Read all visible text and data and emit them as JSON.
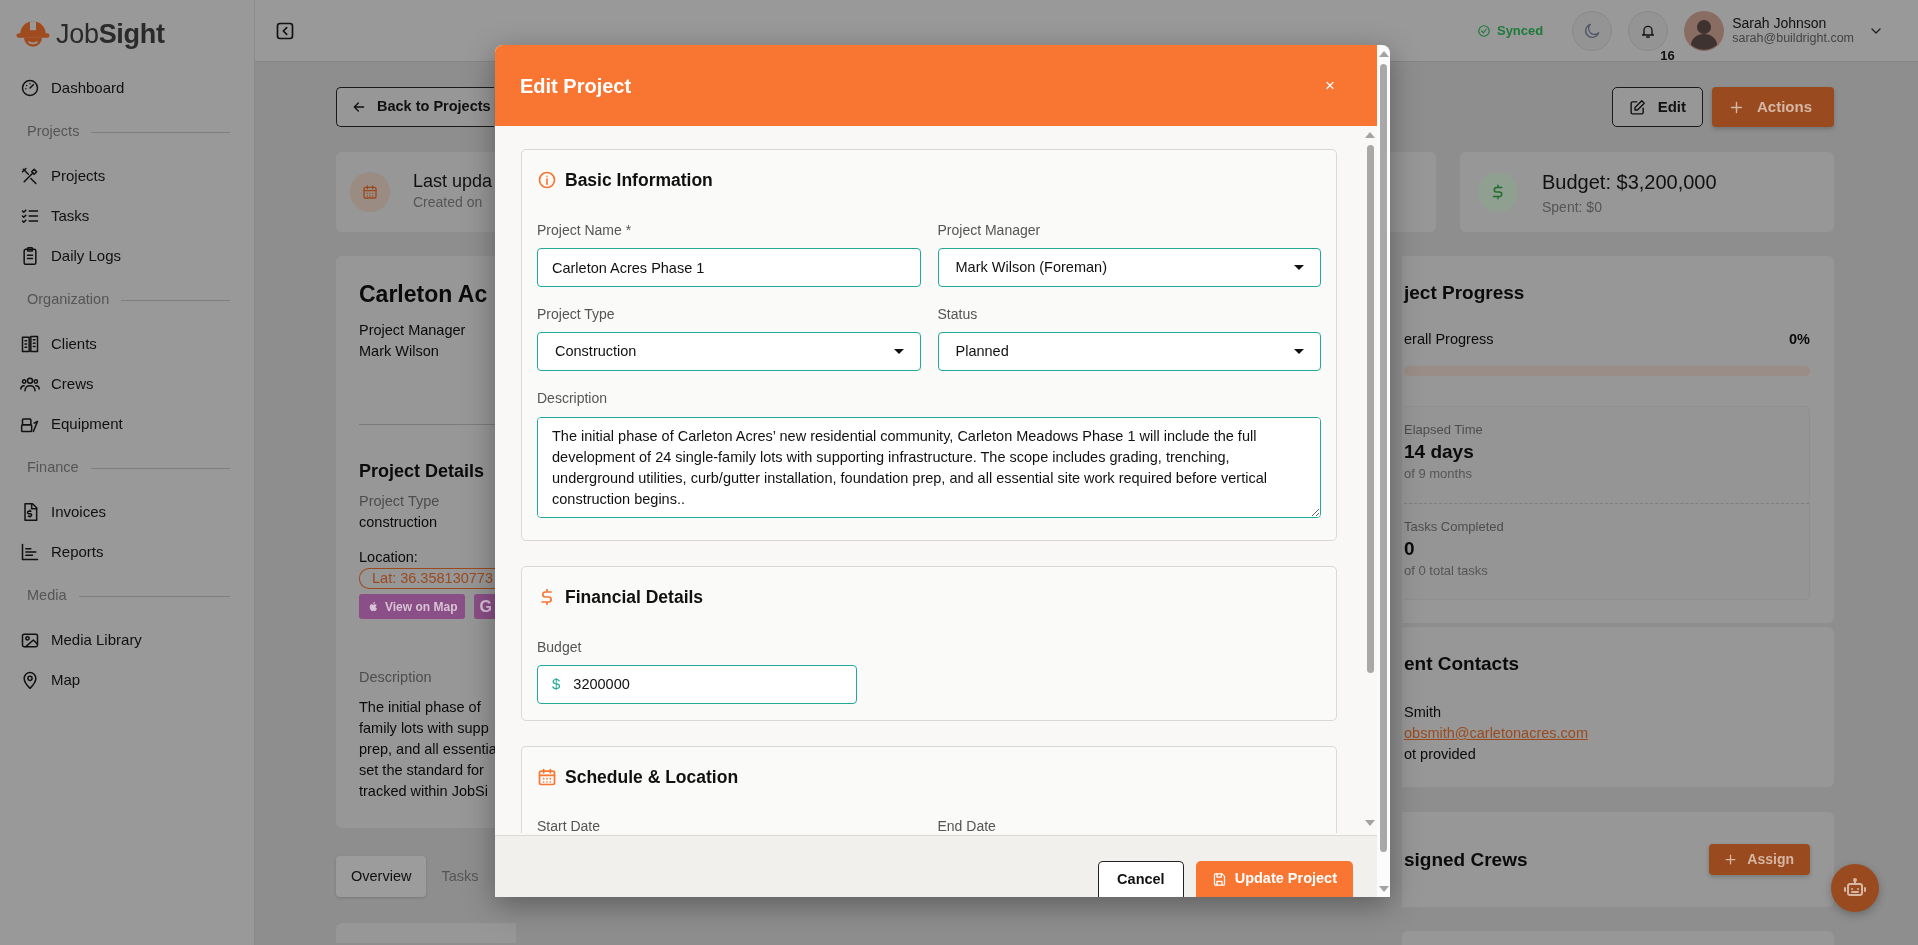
{
  "sidebar": {
    "logo": "Job**Sight**",
    "items": [
      {
        "kind": "link",
        "label": "Dashboard"
      },
      {
        "kind": "heading",
        "label": "Projects"
      },
      {
        "kind": "link",
        "label": "Projects"
      },
      {
        "kind": "link",
        "label": "Tasks"
      },
      {
        "kind": "link",
        "label": "Daily Logs"
      },
      {
        "kind": "heading",
        "label": "Organization"
      },
      {
        "kind": "link",
        "label": "Clients"
      },
      {
        "kind": "link",
        "label": "Crews"
      },
      {
        "kind": "link",
        "label": "Equipment"
      },
      {
        "kind": "heading",
        "label": "Finance"
      },
      {
        "kind": "link",
        "label": "Invoices"
      },
      {
        "kind": "link",
        "label": "Reports"
      },
      {
        "kind": "heading",
        "label": "Media"
      },
      {
        "kind": "link",
        "label": "Media Library"
      },
      {
        "kind": "link",
        "label": "Map"
      }
    ]
  },
  "header": {
    "sync_status": "Synced",
    "notification_count": "16",
    "user": {
      "name": "Sarah Johnson",
      "email": "sarah@buildright.com"
    }
  },
  "page": {
    "back_button": "Back to Projects",
    "edit_button": "Edit",
    "actions_button": "Actions",
    "stat_cards": [
      {
        "title": "Last upda",
        "subtitle": "Created on"
      },
      {
        "title": "Budget: $3,200,000",
        "subtitle": "Spent: $0"
      }
    ],
    "project": {
      "title": "Carleton Ac",
      "manager_label": "Project Manager",
      "manager": "Mark Wilson",
      "details_heading": "Project Details",
      "type_label": "Project Type",
      "type": "construction",
      "location_label": "Location:",
      "coordinates": "Lat: 36.358130773",
      "map_buttons": [
        "View on Map",
        "G"
      ],
      "description_label": "Description",
      "description_lines": [
        "The initial phase of",
        "family lots with supp",
        "prep, and all essentia",
        "set the standard for",
        "tracked within JobSi"
      ]
    },
    "tabs": [
      {
        "label": "Overview",
        "selected": true
      },
      {
        "label": "Tasks",
        "selected": false
      }
    ],
    "progress": {
      "title": "ject Progress",
      "overall_label": "erall Progress",
      "percent": "0%",
      "level": 0,
      "stats": [
        {
          "label": "Elapsed Time",
          "value": "14 days",
          "note": "of 9 months"
        },
        {
          "label": "Tasks Completed",
          "value": "0",
          "note": "of 0 total tasks"
        }
      ]
    },
    "contacts": {
      "title": "ent Contacts",
      "name": "Smith",
      "email": "obsmith@carletonacres.com",
      "phone": "ot provided"
    },
    "crews": {
      "title": "signed Crews",
      "assign_button": "Assign"
    }
  },
  "modal": {
    "title": "Edit Project",
    "close": "×",
    "sections": [
      {
        "kind": "basic",
        "title": "Basic Information",
        "fields": [
          {
            "kind": "text",
            "label": "Project Name *",
            "value": "Carleton Acres Phase 1"
          },
          {
            "kind": "select",
            "label": "Project Manager",
            "value": "Mark Wilson (Foreman)"
          },
          {
            "kind": "select",
            "label": "Project Type",
            "value": "Construction"
          },
          {
            "kind": "select",
            "label": "Status",
            "value": "Planned"
          },
          {
            "kind": "textarea",
            "label": "Description",
            "value": "The initial phase of Carleton Acres’ new residential community, Carleton Meadows Phase 1 will include the full development of 24 single-family lots with supporting infrastructure. The scope includes grading, trenching, underground utilities, curb/gutter installation, foundation prep, and all essential site work required before vertical construction begins.."
          }
        ]
      },
      {
        "kind": "financial",
        "title": "Financial Details",
        "fields": [
          {
            "kind": "currency",
            "label": "Budget",
            "prefix": "$",
            "value": "3200000"
          }
        ]
      },
      {
        "kind": "schedule",
        "title": "Schedule & Location",
        "fields": [
          {
            "kind": "label",
            "label": "Start Date"
          },
          {
            "kind": "label",
            "label": "End Date"
          }
        ]
      }
    ],
    "buttons": [
      {
        "kind": "secondary",
        "label": "Cancel"
      },
      {
        "kind": "primary",
        "label": "Update Project"
      }
    ]
  }
}
